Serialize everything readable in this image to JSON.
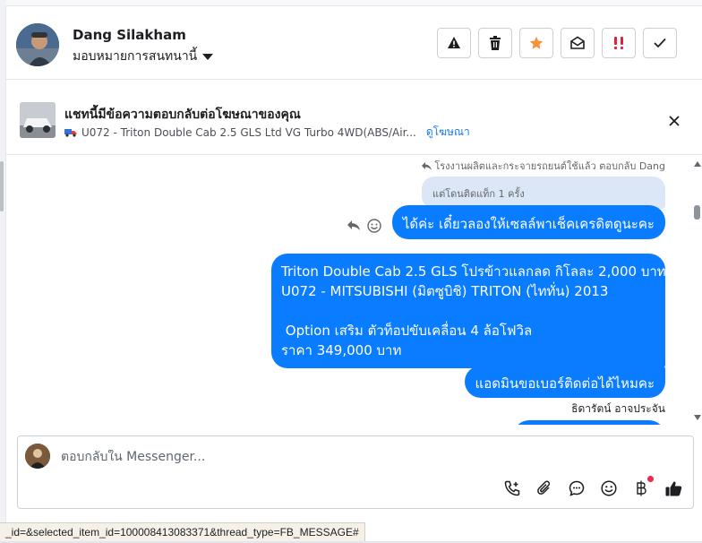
{
  "header": {
    "name": "Dang Silakham",
    "assign_label": "มอบหมายการสนทนานี้",
    "actions": [
      {
        "icon": "alert-triangle-icon"
      },
      {
        "icon": "trash-icon"
      },
      {
        "icon": "star-icon",
        "color": "#f7923a"
      },
      {
        "icon": "open-envelope-icon"
      },
      {
        "icon": "double-exclamation-icon",
        "color": "#e41e3f"
      },
      {
        "icon": "check-icon"
      }
    ]
  },
  "ad": {
    "title": "แชทนี้มีข้อความตอบกลับต่อโฆษณาของคุณ",
    "product": "U072 - Triton Double Cab 2.5 GLS Ltd VG Turbo 4WD(ABS/Air...",
    "view_link": "ดูโฆษณา"
  },
  "conversation": {
    "reply_meta": "โรงงานผลิตและกระจายรถยนต์ใช้แล้ว ตอบกลับ Dang",
    "replied_to": "แต่โดนติดแท็ก 1 ครั้ง",
    "messages": [
      {
        "lines": [
          "ได้ค่ะ เดี๋ยวลองให้เซลล์พาเช็คเครดิตดูนะคะ"
        ]
      },
      {
        "lines": [
          "Triton Double Cab 2.5 GLS โปรข้าวแลกลด กิโลละ 2,000 บาท",
          "U072 - MITSUBISHI (มิตซูบิชิ) TRITON (ไททั่น) 2013",
          "",
          " Option เสริม ตัวท็อปขับเคลื่อน 4 ล้อโฟวิล",
          "ราคา 349,000 บาท"
        ]
      },
      {
        "lines": [
          "แอดมินขอเบอร์ติดต่อได้ไหมคะ"
        ]
      }
    ],
    "sender": "ธิดารัตน์ อาจประจัน",
    "bubble_color": "#0a7cff"
  },
  "composer": {
    "placeholder": "ตอบกลับใน Messenger...",
    "tools": [
      "phone-add-icon",
      "paperclip-icon",
      "chat-bubble-icon",
      "emoji-icon",
      "baht-icon",
      "thumbs-up-icon"
    ]
  },
  "status_url": "_id=&selected_item_id=100008413083371&thread_type=FB_MESSAGE#"
}
